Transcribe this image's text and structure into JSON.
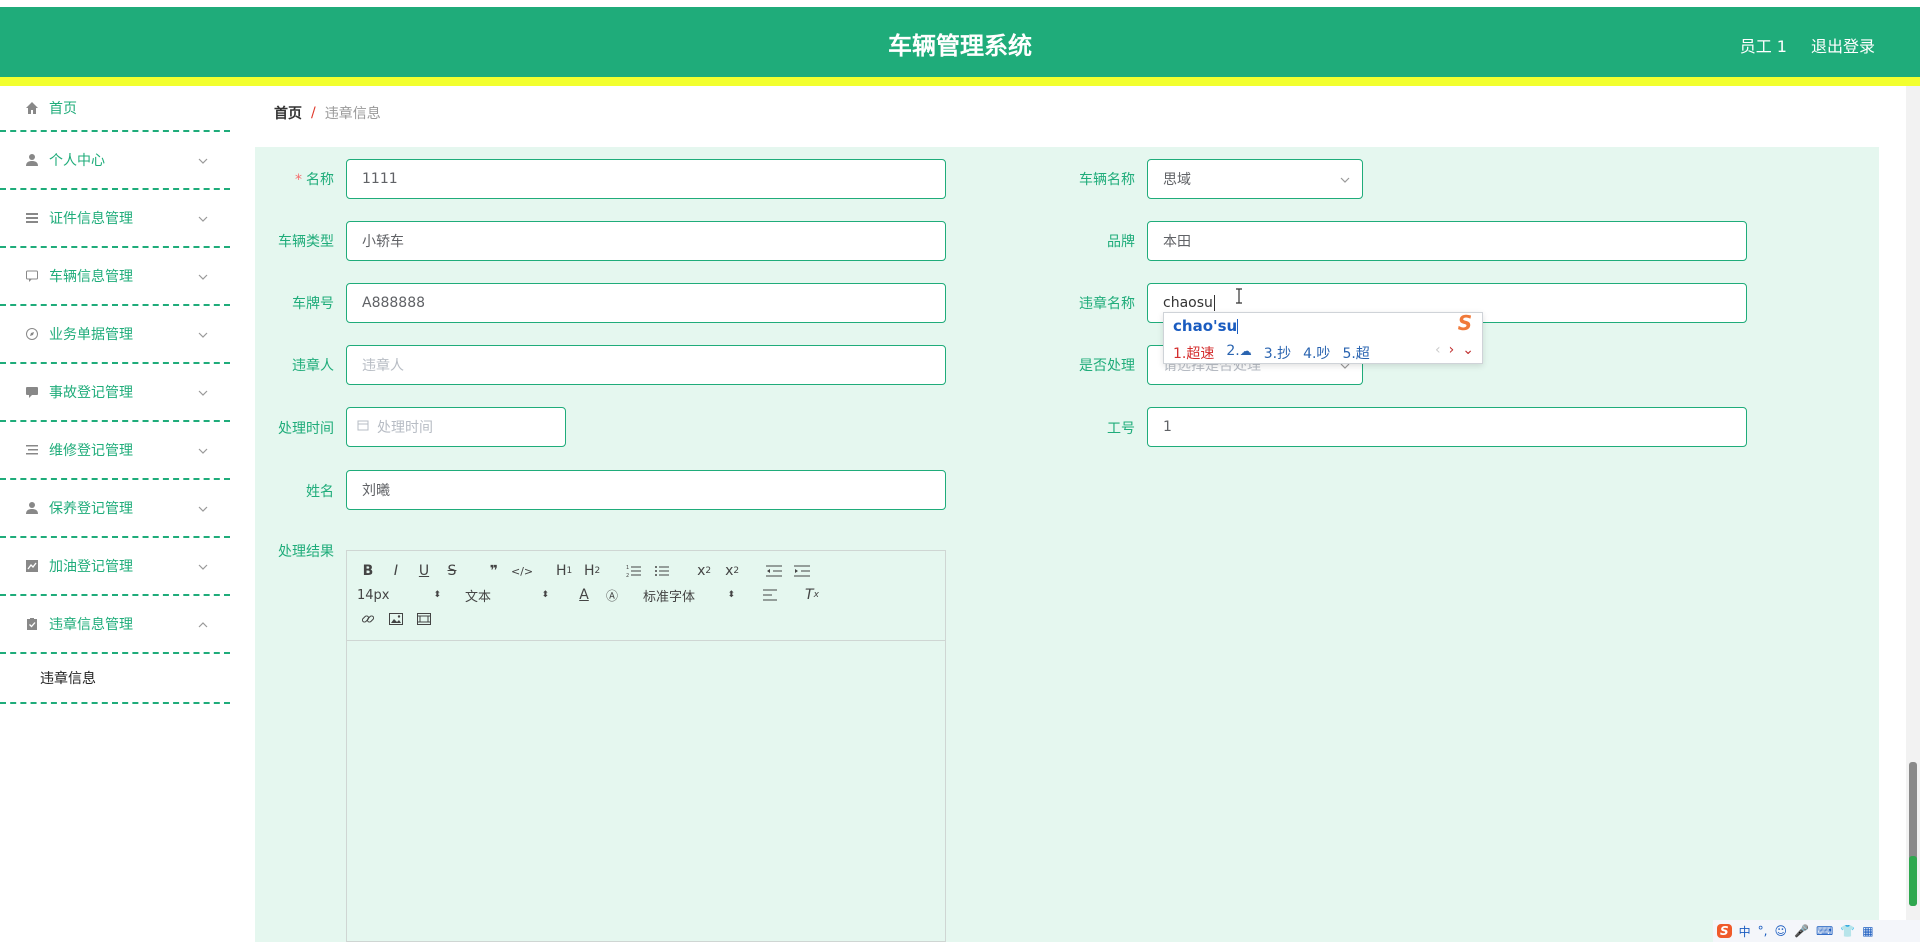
{
  "header": {
    "title": "车辆管理系统",
    "user": "员工 1",
    "logout": "退出登录"
  },
  "sidebar": {
    "items": [
      {
        "label": "首页",
        "icon": "home-icon"
      },
      {
        "label": "个人中心",
        "icon": "user-icon"
      },
      {
        "label": "证件信息管理",
        "icon": "list-icon"
      },
      {
        "label": "车辆信息管理",
        "icon": "chat-icon"
      },
      {
        "label": "业务单据管理",
        "icon": "compass-icon"
      },
      {
        "label": "事故登记管理",
        "icon": "message-icon"
      },
      {
        "label": "维修登记管理",
        "icon": "list-icon"
      },
      {
        "label": "保养登记管理",
        "icon": "user-icon"
      },
      {
        "label": "加油登记管理",
        "icon": "chart-icon"
      },
      {
        "label": "违章信息管理",
        "icon": "clipboard-icon"
      }
    ],
    "submenu": {
      "label": "违章信息"
    }
  },
  "breadcrumb": {
    "home": "首页",
    "separator": "/",
    "current": "违章信息"
  },
  "form": {
    "name": {
      "label": "名称",
      "value": "1111"
    },
    "vehicle_name": {
      "label": "车辆名称",
      "value": "思域"
    },
    "vehicle_type": {
      "label": "车辆类型",
      "value": "小轿车"
    },
    "brand": {
      "label": "品牌",
      "value": "本田"
    },
    "plate": {
      "label": "车牌号",
      "value": "A888888"
    },
    "violation_name": {
      "label": "违章名称",
      "value": "chaosu"
    },
    "violator": {
      "label": "违章人",
      "placeholder": "违章人"
    },
    "handled": {
      "label": "是否处理",
      "placeholder": "请选择是否处理"
    },
    "handle_time": {
      "label": "处理时间",
      "placeholder": "处理时间"
    },
    "employee_no": {
      "label": "工号",
      "value": "1"
    },
    "full_name": {
      "label": "姓名",
      "value": "刘曦"
    },
    "result": {
      "label": "处理结果"
    }
  },
  "editor": {
    "font_size": "14px",
    "header_select": "文本",
    "font_family": "标准字体"
  },
  "ime": {
    "composition": "chao'su",
    "candidates": [
      "1.超速",
      "2.",
      "3.抄",
      "4.吵",
      "5.超"
    ]
  },
  "tray": {
    "lang": "中",
    "punct": "°,"
  },
  "colors": {
    "primary": "#1fac7a",
    "strip": "#f2ff2f",
    "form_bg": "#e5f7ef"
  }
}
